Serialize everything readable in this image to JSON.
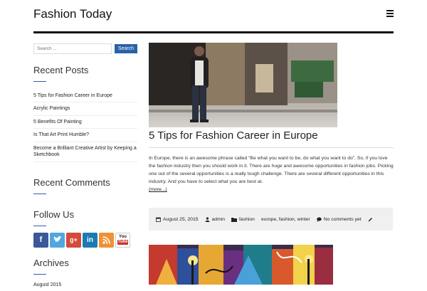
{
  "header": {
    "site_title": "Fashion Today",
    "menu_icon": "hamburger-menu-icon"
  },
  "sidebar": {
    "search": {
      "placeholder": "Search ...",
      "button_label": "Search"
    },
    "recent_posts": {
      "title": "Recent Posts",
      "items": [
        "5 Tips for Fashion Career in Europe",
        "Acrylic Paintings",
        "5 Benefits Of Painting",
        "Is That Art Print Humble?",
        "Become a Brilliant Creative Artist by Keeping a Sketchbook"
      ]
    },
    "recent_comments": {
      "title": "Recent Comments"
    },
    "follow_us": {
      "title": "Follow Us",
      "icons": [
        "facebook-icon",
        "twitter-icon",
        "google-plus-icon",
        "linkedin-icon",
        "rss-icon",
        "youtube-icon"
      ],
      "colors": [
        "#3b5998",
        "#4fa7e0",
        "#d44b3a",
        "#1b7bb5",
        "#f09137",
        "#c8312a"
      ]
    },
    "archives": {
      "title": "Archives",
      "items": [
        "August 2015"
      ]
    }
  },
  "post": {
    "title": "5 Tips for Fashion Career in Europe",
    "excerpt": "In Europe, there is an awesome phrase called “Be what you want to be, do what you want to do”. So, if you love the fashion industry then you should work in it. There are huge and awesome opportunities in fashion jobs. Picking one out of the several opportunities is a really tough challenge. There are several different opportunities in this industry. And you have to select what you are best at.",
    "more": "(more...)",
    "meta": {
      "date": "August 25, 2015",
      "author": "admin",
      "category": "fashion",
      "tags": "europe, fashion, winter",
      "comments": "No comments yet"
    }
  },
  "colors": {
    "accent": "#2a62a8",
    "header_rule": "#111111",
    "meta_bg": "#f0f0f0"
  }
}
